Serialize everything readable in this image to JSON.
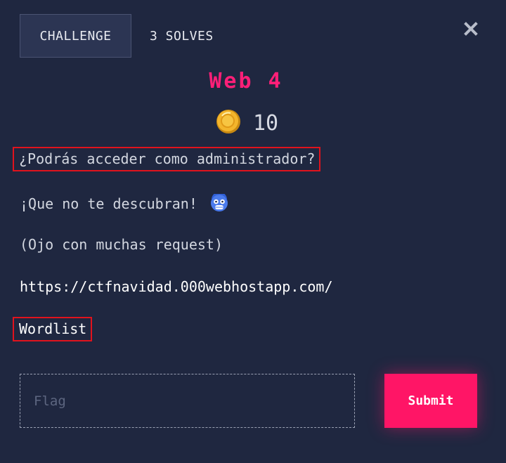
{
  "tabs": {
    "challenge": "CHALLENGE",
    "solves": "3 SOLVES"
  },
  "challenge": {
    "title": "Web 4",
    "points": "10",
    "description": [
      "¿Podrás acceder como administrador?",
      "¡Que no te descubran!",
      "(Ojo con muchas request)",
      "https://ctfnavidad.000webhostapp.com/",
      "Wordlist"
    ],
    "emoji": "😱"
  },
  "form": {
    "flag_placeholder": "Flag",
    "submit_label": "Submit"
  },
  "colors": {
    "background": "#1f2740",
    "accent": "#ff1566",
    "title": "#ff1f78",
    "highlight_box": "#e0131d"
  },
  "icons": {
    "close": "close-icon",
    "coin": "coin-icon",
    "emoji": "scared-face-icon"
  }
}
